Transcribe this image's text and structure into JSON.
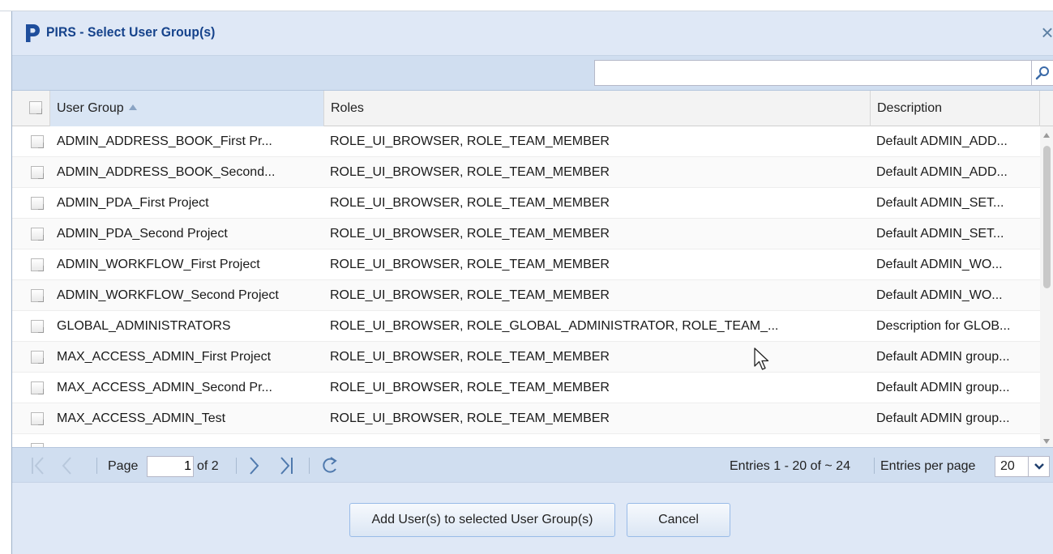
{
  "dialog": {
    "title": "PIRS - Select User Group(s)",
    "close_glyph": "×",
    "logo": "pirs-p-logo"
  },
  "search": {
    "placeholder": "",
    "value": "",
    "icon": "search-icon"
  },
  "grid": {
    "columns": [
      {
        "label": "User Group",
        "sorted": "ascending"
      },
      {
        "label": "Roles"
      },
      {
        "label": "Description"
      }
    ],
    "rows": [
      {
        "group": "ADMIN_ADDRESS_BOOK_First Pr...",
        "roles": "ROLE_UI_BROWSER, ROLE_TEAM_MEMBER",
        "description": "Default ADMIN_ADD..."
      },
      {
        "group": "ADMIN_ADDRESS_BOOK_Second...",
        "roles": "ROLE_UI_BROWSER, ROLE_TEAM_MEMBER",
        "description": "Default ADMIN_ADD..."
      },
      {
        "group": "ADMIN_PDA_First Project",
        "roles": "ROLE_UI_BROWSER, ROLE_TEAM_MEMBER",
        "description": "Default ADMIN_SET..."
      },
      {
        "group": "ADMIN_PDA_Second Project",
        "roles": "ROLE_UI_BROWSER, ROLE_TEAM_MEMBER",
        "description": "Default ADMIN_SET..."
      },
      {
        "group": "ADMIN_WORKFLOW_First Project",
        "roles": "ROLE_UI_BROWSER, ROLE_TEAM_MEMBER",
        "description": "Default ADMIN_WO..."
      },
      {
        "group": "ADMIN_WORKFLOW_Second Project",
        "roles": "ROLE_UI_BROWSER, ROLE_TEAM_MEMBER",
        "description": "Default ADMIN_WO..."
      },
      {
        "group": "GLOBAL_ADMINISTRATORS",
        "roles": "ROLE_UI_BROWSER, ROLE_GLOBAL_ADMINISTRATOR, ROLE_TEAM_...",
        "description": "Description for GLOB..."
      },
      {
        "group": "MAX_ACCESS_ADMIN_First Project",
        "roles": "ROLE_UI_BROWSER, ROLE_TEAM_MEMBER",
        "description": "Default ADMIN group..."
      },
      {
        "group": "MAX_ACCESS_ADMIN_Second Pr...",
        "roles": "ROLE_UI_BROWSER, ROLE_TEAM_MEMBER",
        "description": "Default ADMIN group..."
      },
      {
        "group": "MAX_ACCESS_ADMIN_Test",
        "roles": "ROLE_UI_BROWSER, ROLE_TEAM_MEMBER",
        "description": "Default ADMIN group..."
      }
    ]
  },
  "pager": {
    "page_label": "Page",
    "current_page": "1",
    "of_label": "of 2",
    "entries_text": "Entries 1 - 20 of ~ 24",
    "per_page_label": "Entries per page",
    "per_page_value": "20"
  },
  "footer": {
    "add_label": "Add User(s) to selected User Group(s)",
    "cancel_label": "Cancel"
  },
  "colors": {
    "title": "#15428b",
    "toolbar_bg": "#d0def0",
    "dialog_bg": "#dfe8f6",
    "logo": "#1f4e9c"
  }
}
